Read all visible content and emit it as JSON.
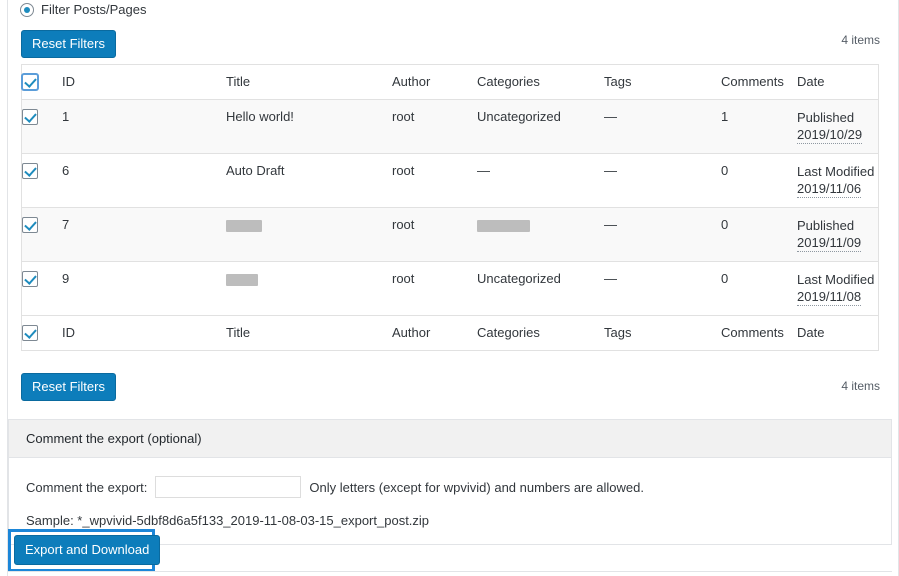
{
  "filter": {
    "radio_label": "Filter Posts/Pages",
    "radio_selected": true
  },
  "toolbar": {
    "reset_label": "Reset Filters",
    "items_count_top": "4 items",
    "items_count_bottom": "4 items"
  },
  "table": {
    "columns": [
      "ID",
      "Title",
      "Author",
      "Categories",
      "Tags",
      "Comments",
      "Date"
    ],
    "rows": [
      {
        "id": "1",
        "title": "Hello world!",
        "title_redacted": false,
        "author": "root",
        "categories": "Uncategorized",
        "categories_redacted": false,
        "tags": "—",
        "comments": "1",
        "date_status": "Published",
        "date_value": "2019/10/29",
        "checked": true
      },
      {
        "id": "6",
        "title": "Auto Draft",
        "title_redacted": false,
        "author": "root",
        "categories": "—",
        "categories_redacted": false,
        "tags": "—",
        "comments": "0",
        "date_status": "Last Modified",
        "date_value": "2019/11/06",
        "checked": true
      },
      {
        "id": "7",
        "title": "",
        "title_redacted": true,
        "author": "root",
        "categories": "",
        "categories_redacted": true,
        "tags": "—",
        "comments": "0",
        "date_status": "Published",
        "date_value": "2019/11/09",
        "checked": true
      },
      {
        "id": "9",
        "title": "",
        "title_redacted": true,
        "author": "root",
        "categories": "Uncategorized",
        "categories_redacted": false,
        "tags": "—",
        "comments": "0",
        "date_status": "Last Modified",
        "date_value": "2019/11/08",
        "checked": true
      }
    ]
  },
  "comment_panel": {
    "header": "Comment the export (optional)",
    "field_label": "Comment the export:",
    "field_value": "",
    "field_placeholder": "",
    "hint": "Only letters (except for wpvivid) and numbers are allowed.",
    "sample": "Sample: *_wpvivid-5dbf8d6a5f133_2019-11-08-03-15_export_post.zip"
  },
  "export": {
    "button_label": "Export and Download",
    "highlight_color": "#1b86d8"
  },
  "colors": {
    "primary_button": "#0d7dbb",
    "radio_dot": "#1e8cbe",
    "checkbox_check": "#1e8cbe",
    "alt_row": "#f9f9f9",
    "panel_header": "#f1f1f1"
  }
}
